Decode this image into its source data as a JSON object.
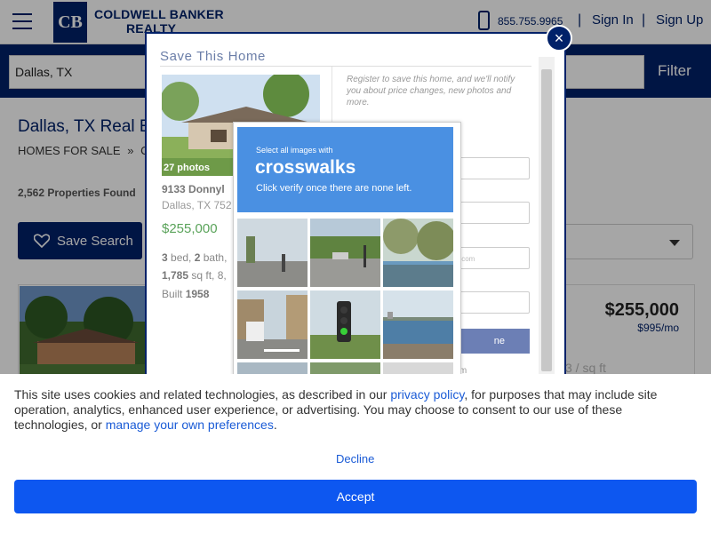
{
  "header": {
    "brand_line1": "COLDWELL BANKER",
    "brand_line2": "REALTY",
    "logo_mark": "CB",
    "phone": "855.755.9965",
    "separator": "|",
    "sign_in": "Sign In",
    "sign_up": "Sign Up"
  },
  "search": {
    "value": "Dallas, TX",
    "filter_label": "Filter"
  },
  "results": {
    "title": "Dallas, TX Real E",
    "breadcrumb_1": "HOMES FOR SALE",
    "breadcrumb_sep": "»",
    "breadcrumb_2": "C",
    "count": "2,562 Properties Found",
    "save_search_label": "Save Search"
  },
  "listing": {
    "price": "$255,000",
    "rent": "$995/mo",
    "sqft_partial": "3 / sq ft"
  },
  "modal": {
    "title": "Save This Home",
    "close": "×",
    "photo_count": "27 photos",
    "address": "9133 Donnyl",
    "city": "Dallas, TX 752",
    "price": "$255,000",
    "beds_num": "3",
    "beds_label": " bed, ",
    "baths_num": "2",
    "baths_label": " bath,",
    "sqft_num": "1,785",
    "sqft_label": " sq ft, 8,",
    "built_label": "Built ",
    "built_year": "1958",
    "register_note": "Register to save this home, and we'll notify you about price changes, new photos and more.",
    "email_placeholder_partial": "ail.com",
    "submit_partial": "ne",
    "form_tail": "orm"
  },
  "captcha": {
    "subtitle": "Select all images with",
    "keyword": "crosswalks",
    "instruction": "Click verify once there are none left."
  },
  "cookie": {
    "text_1": "This site uses cookies and related technologies, as described in our ",
    "privacy_link": "privacy policy",
    "text_2": ", for purposes that may include site operation, analytics, enhanced user experience, or advertising. You may choose to consent to our use of these technologies, or ",
    "prefs_link": "manage your own preferences",
    "text_3": ".",
    "decline": "Decline",
    "accept": "Accept"
  },
  "colors": {
    "brand_navy": "#012169",
    "captcha_blue": "#4a90e2",
    "accept_blue": "#0d57f0",
    "price_green": "#5aa35a"
  },
  "icons": [
    "hamburger-icon",
    "phone-icon",
    "heart-icon",
    "chevron-down-icon",
    "close-icon"
  ]
}
